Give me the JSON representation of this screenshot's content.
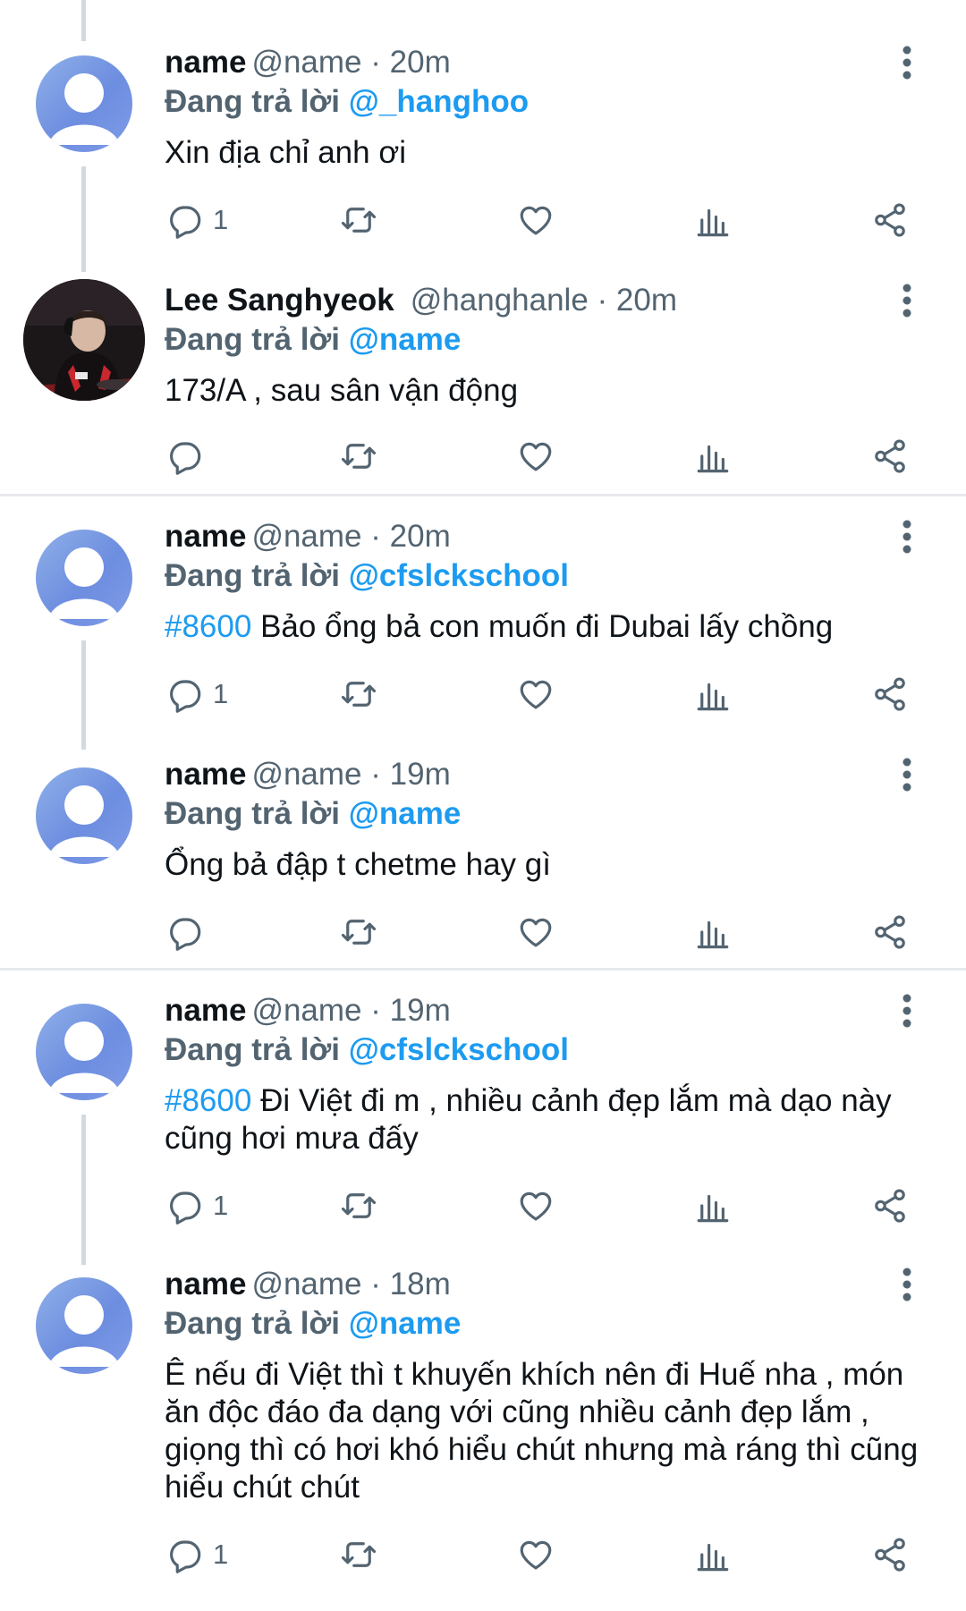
{
  "labels": {
    "replying_to": "Đang trả lời"
  },
  "colors": {
    "link": "#1d9bf0",
    "muted": "#536471",
    "thread_line": "#d4d9de"
  },
  "tweets": [
    {
      "name": "name",
      "handle": "@name",
      "time": "20m",
      "reply_to": "@_hanghoo",
      "hashtag": "",
      "text": "Xin địa chỉ anh ơi",
      "reply_count": "1",
      "avatar": "default-avatar-icon"
    },
    {
      "name": "Lee Sanghyeok",
      "handle": "@hanghanle",
      "time": "20m",
      "reply_to": "@name",
      "hashtag": "",
      "text": "173/A , sau sân vận động",
      "reply_count": "",
      "avatar": "profile-photo"
    },
    {
      "name": "name",
      "handle": "@name",
      "time": "20m",
      "reply_to": "@cfslckschool",
      "hashtag": "#8600",
      "text": "Bảo ổng bả con muốn đi Dubai lấy chồng",
      "reply_count": "1",
      "avatar": "default-avatar-icon"
    },
    {
      "name": "name",
      "handle": "@name",
      "time": "19m",
      "reply_to": "@name",
      "hashtag": "",
      "text": "Ổng bả đập t chetme hay gì",
      "reply_count": "",
      "avatar": "default-avatar-icon"
    },
    {
      "name": "name",
      "handle": "@name",
      "time": "19m",
      "reply_to": "@cfslckschool",
      "hashtag": "#8600",
      "text": "Đi Việt đi m , nhiều cảnh đẹp lắm mà dạo này cũng hơi mưa đấy",
      "reply_count": "1",
      "avatar": "default-avatar-icon"
    },
    {
      "name": "name",
      "handle": "@name",
      "time": "18m",
      "reply_to": "@name",
      "hashtag": "",
      "text": "Ê nếu đi Việt thì t khuyến khích nên đi Huế nha , món ăn độc đáo đa dạng với cũng nhiều cảnh đẹp lắm , giọng thì có hơi khó hiểu chút nhưng mà ráng thì cũng hiểu chút chút",
      "reply_count": "1",
      "avatar": "default-avatar-icon"
    }
  ]
}
